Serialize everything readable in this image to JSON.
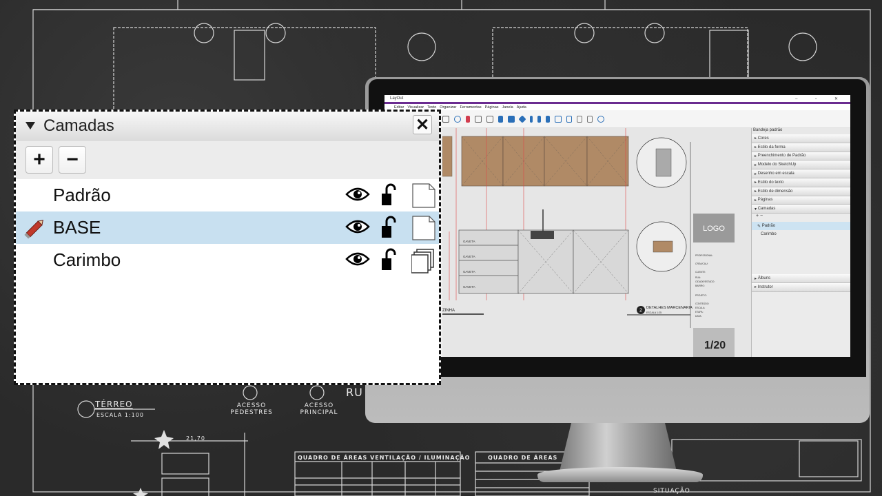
{
  "layers_panel": {
    "title": "Camadas",
    "close_label": "✕",
    "add_label": "+",
    "remove_label": "−",
    "layers": [
      {
        "name": "Padrão",
        "active": false,
        "icon": "page-icon"
      },
      {
        "name": "BASE",
        "active": true,
        "icon": "page-icon"
      },
      {
        "name": "Carimbo",
        "active": false,
        "icon": "shared-pages-icon"
      }
    ]
  },
  "background": {
    "terreo": "TÉRREO",
    "escala": "ESCALA 1:100",
    "acesso_pedestres": "ACESSO\nPEDESTRES",
    "acesso_principal": "ACESSO\nPRINCIPAL",
    "ru": "RU",
    "quadro_areas_vent": "QUADRO DE ÁREAS VENTILAÇÃO / ILUMINAÇÃO",
    "quadro_areas": "QUADRO DE ÁREAS",
    "situacao": "SITUAÇÃO",
    "dimension": "21,70"
  },
  "layout_app": {
    "title": "LayOut",
    "menus": [
      "Editar",
      "Visualizar",
      "Texto",
      "Organizar",
      "Ferramentas",
      "Páginas",
      "Janela",
      "Ajuda"
    ],
    "tray_title": "Bandeja padrão",
    "tray_panels": [
      "Cores",
      "Estilo da forma",
      "Preenchimento de Padrão",
      "Modelo do SketchUp",
      "Desenho em escala",
      "Estilo do texto",
      "Estilo de dimensão",
      "Páginas",
      "Camadas"
    ],
    "tray_layers": [
      {
        "name": "Padrão",
        "active": true
      },
      {
        "name": "Carimbo",
        "active": false
      }
    ],
    "tray_bottom": [
      "Álbuns",
      "Instrutor"
    ],
    "canvas": {
      "logo": "LOGO",
      "page_number": "1/20",
      "detail_number": "2",
      "detail_title": "DETALHES MARCENARIA",
      "detail_scale": "ESCALA 1:25",
      "cozinha": "ZINHA",
      "gaveta": "GAVETA",
      "stamp_labels": [
        "PROFISSIONAL:",
        "CREA/CAU:",
        "CLIENTE:",
        "RUA:",
        "CIDADE/ESTADO:",
        "BAIRRO:",
        "PROJETO:",
        "CONTEÚDO:",
        "ESCALA:",
        "ETAPA:",
        "DATA:"
      ]
    }
  },
  "colors": {
    "accent": "#6b2c91",
    "selected_row": "#c8e0f0",
    "wood": "#b08a66"
  }
}
